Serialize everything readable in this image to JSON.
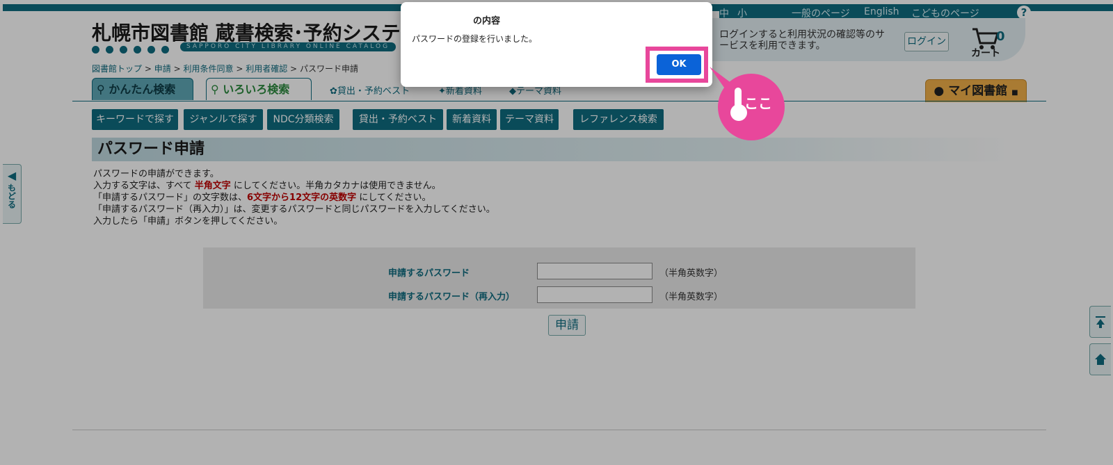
{
  "header": {
    "font_size_small": "中",
    "font_size_smaller": "小",
    "general_page": "一般のページ",
    "english": "English",
    "kids_page": "こどものページ",
    "help": "?",
    "logo_title": "札幌市図書館 蔵書検索･予約システム",
    "logo_subtitle": "SAPPORO CITY LIBRARY ONLINE CATALOG",
    "login_message": "ログインすると利用状況の確認等のサービスを利用できます。",
    "login_button": "ログイン",
    "cart_count": "0",
    "cart_label": "カート"
  },
  "breadcrumb": {
    "items": [
      "図書館トップ",
      "申請",
      "利用条件同意",
      "利用者確認"
    ],
    "separator": ">",
    "current": "パスワード申請"
  },
  "tabs": {
    "simple_search": "かんたん検索",
    "various_search": "いろいろ検索",
    "best": "貸出・予約ベスト",
    "new": "新着資料",
    "theme": "テーマ資料",
    "my_library": "マイ図書館"
  },
  "subnav": [
    "キーワードで探す",
    "ジャンルで探す",
    "NDC分類検索",
    "貸出・予約ベスト",
    "新着資料",
    "テーマ資料",
    "レファレンス検索"
  ],
  "page": {
    "title": "パスワード申請",
    "line1": "パスワードの申請ができます。",
    "line2_a": "入力する文字は、すべて ",
    "line2_b": "半角文字",
    "line2_c": " にしてください。半角カタカナは使用できません。",
    "line3_a": "「申請するパスワード」の文字数は、",
    "line3_b": "6文字から12文字の英数字",
    "line3_c": " にしてください。",
    "line4": "「申請するパスワード（再入力）」は、変更するパスワードと同じパスワードを入力してください。",
    "line5": "入力したら「申請」ボタンを押してください。"
  },
  "form": {
    "password_label": "申請するパスワード",
    "password_confirm_label": "申請するパスワード（再入力）",
    "hint": "（半角英数字）",
    "submit": "申請"
  },
  "side": {
    "back": "もどる"
  },
  "dialog": {
    "title": "の内容",
    "message": "パスワードの登録を行いました。",
    "ok": "OK"
  },
  "callout": {
    "text": "ここ"
  },
  "colors": {
    "accent": "#0f6c80",
    "highlight": "#e8479b",
    "ok_button": "#0b63d8"
  }
}
